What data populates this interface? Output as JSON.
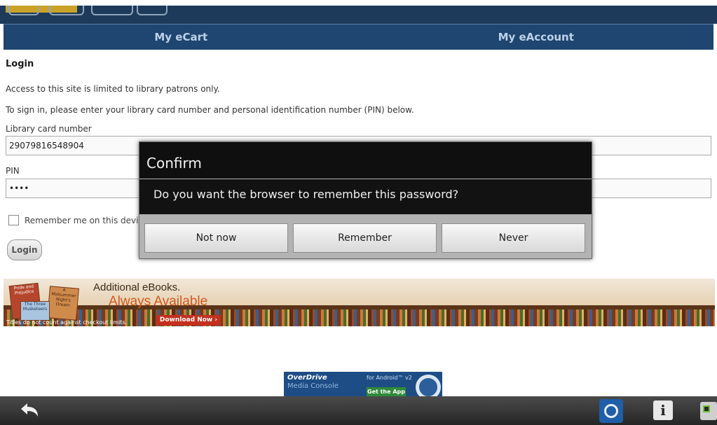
{
  "nav": {
    "cart": "My eCart",
    "account": "My eAccount"
  },
  "login": {
    "title": "Login",
    "line1": "Access to this site is limited to library patrons only.",
    "line2": "To sign in, please enter your library card number and personal identification number (PIN) below.",
    "card_label": "Library card number",
    "card_value": "29079816548904",
    "pin_label": "PIN",
    "pin_value": "••••",
    "remember_label": "Remember me on this devic",
    "button": "Login"
  },
  "banner": {
    "line1": "Additional eBooks.",
    "line2": "Always Available",
    "download": "Download Now ›",
    "note": "Titles do not count against checkout limits.",
    "book1": "Pride and Prejudice",
    "book2": "A Midsummer Night's Dream",
    "book3": "The Three Musketeers"
  },
  "promo": {
    "brand": "OverDrive",
    "sub": "Media Console",
    "android": "for Android™ v2",
    "getapp": "Get the App"
  },
  "dialog": {
    "title": "Confirm",
    "message": "Do you want the browser to remember this password?",
    "not_now": "Not now",
    "remember": "Remember",
    "never": "Never"
  },
  "sysbar": {
    "info": "i"
  },
  "colors": {
    "nav_bg": "#1f4670",
    "accent": "#c9a227",
    "dialog_bg": "#121212"
  },
  "icons": [
    "back-arrow-icon",
    "overdrive-icon",
    "info-icon",
    "device-icon"
  ]
}
